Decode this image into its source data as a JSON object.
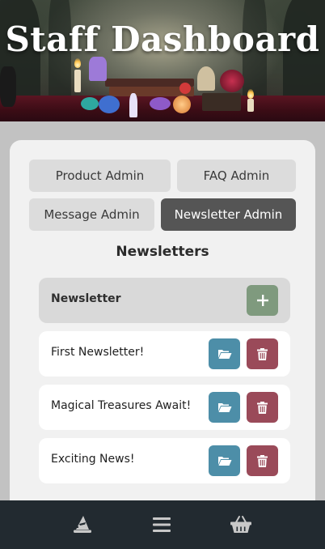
{
  "header": {
    "title": "Staff Dashboard"
  },
  "tabs": [
    {
      "label": "Product Admin",
      "active": false
    },
    {
      "label": "FAQ Admin",
      "active": false
    },
    {
      "label": "Message Admin",
      "active": false
    },
    {
      "label": "Newsletter Admin",
      "active": true
    }
  ],
  "newsletters": {
    "section_title": "Newsletters",
    "list_header": "Newsletter",
    "add_icon": "plus-icon",
    "open_icon": "folder-open-icon",
    "delete_icon": "trash-icon",
    "items": [
      {
        "title": "First Newsletter!"
      },
      {
        "title": "Magical Treasures Await!"
      },
      {
        "title": "Exciting News!"
      }
    ]
  },
  "bottom_nav": {
    "items": [
      {
        "icon": "wizard-hat-icon"
      },
      {
        "icon": "menu-icon"
      },
      {
        "icon": "basket-icon"
      }
    ]
  },
  "colors": {
    "page_bg": "#c2c2c2",
    "card_bg": "#f1f1f1",
    "tab_bg": "#dcdcdc",
    "tab_active_bg": "#555555",
    "add_button": "#7f9a7e",
    "open_button": "#4d8ea8",
    "delete_button": "#9a4a59",
    "nav_bg": "#222a30"
  }
}
